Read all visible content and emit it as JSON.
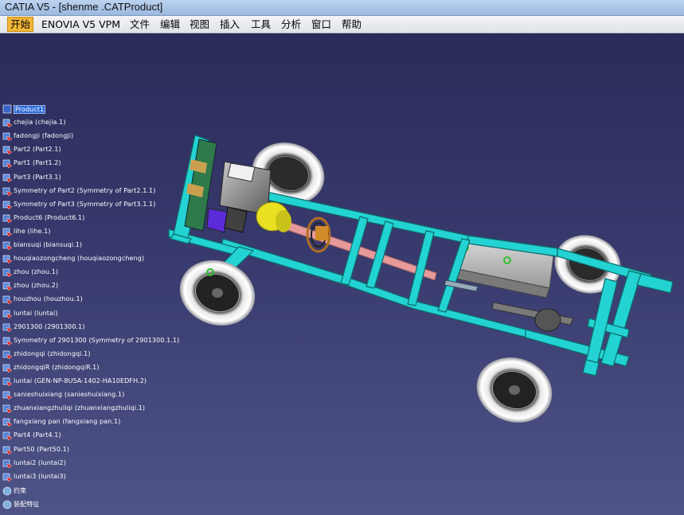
{
  "window": {
    "title": "CATIA V5 - [shenme .CATProduct]"
  },
  "menu": [
    {
      "label": "开始",
      "active": true
    },
    {
      "label": "ENOVIA V5 VPM"
    },
    {
      "label": "文件"
    },
    {
      "label": "编辑"
    },
    {
      "label": "视图"
    },
    {
      "label": "插入"
    },
    {
      "label": "工具"
    },
    {
      "label": "分析"
    },
    {
      "label": "窗口"
    },
    {
      "label": "帮助"
    }
  ],
  "tree": {
    "root": "Product1",
    "items": [
      "chejia (chejia.1)",
      "fadongji (fadongji)",
      "Part2 (Part2.1)",
      "Part1 (Part1.2)",
      "Part3 (Part3.1)",
      "Symmetry of Part2 (Symmetry of Part2.1.1)",
      "Symmetry of Part3 (Symmetry of Part3.1.1)",
      "Product6 (Product6.1)",
      "lihe (lihe.1)",
      "biansuqi (biansuqi.1)",
      "houqiaozongcheng (houqiaozongcheng)",
      "zhou (zhou.1)",
      "zhou (zhou.2)",
      "houzhou (houzhou.1)",
      "luntai (luntai)",
      "2901300 (2901300.1)",
      "Symmetry of 2901300 (Symmetry of 2901300.1.1)",
      "zhidongqi (zhidongqi.1)",
      "zhidongqiR (zhidongqiR.1)",
      "luntai (GEN-NP-8U5A-1402-HA10EDFH.2)",
      "sanieshuixiang (sanieshuixiang.1)",
      "zhuanxiangzhuliqi (zhuanxiangzhuliqi.1)",
      "fangxiang pan (fangxiang pan.1)",
      "Part4 (Part4.1)",
      "Part50 (Part50.1)",
      "luntai2 (luntai2)",
      "luntai3 (luntai3)"
    ],
    "footer": [
      "约束",
      "装配特征"
    ]
  },
  "colors": {
    "frame": "#23d3d3",
    "frame_edge": "#0d6a6a",
    "shaft": "#e89a9a",
    "background": "#2f3163"
  }
}
